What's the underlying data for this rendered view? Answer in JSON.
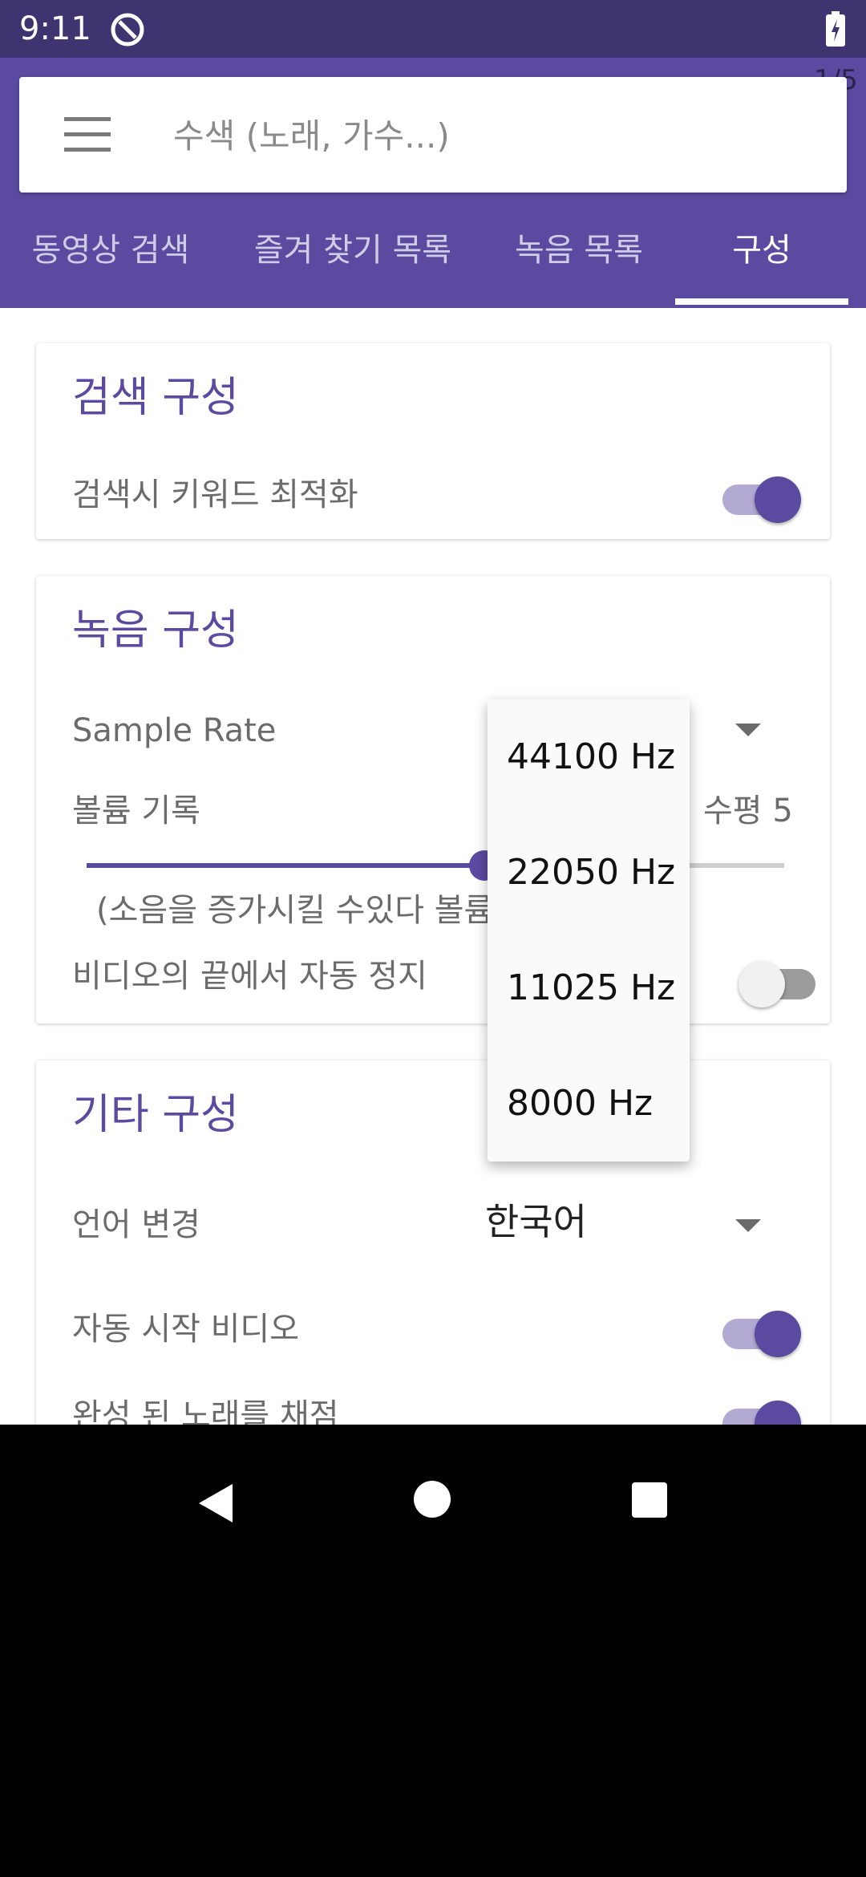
{
  "status_bar": {
    "time": "9:11"
  },
  "page_indicator": "1/5",
  "search": {
    "placeholder": "수색 (노래, 가수...)"
  },
  "tabs": [
    {
      "label": "동영상 검색"
    },
    {
      "label": "즐겨 찾기 목록"
    },
    {
      "label": "녹음 목록"
    },
    {
      "label": "구성",
      "selected": true
    }
  ],
  "search_settings": {
    "title": "검색 구성",
    "keyword_optimization_label": "검색시 키워드 최적화",
    "keyword_optimization_on": true
  },
  "recording_settings": {
    "title": "녹음 구성",
    "sample_rate_label": "Sample Rate",
    "volume_label": "볼륨 기록",
    "volume_level_text": "수평 5",
    "volume_note": "(소음을 증가시킬 수있다 볼륨",
    "volume_fraction": 0.57,
    "auto_stop_label": "비디오의 끝에서 자동 정지",
    "auto_stop_on": false
  },
  "other_settings": {
    "title": "기타 구성",
    "language_label": "언어 변경",
    "language_value": "한국어",
    "autostart_label": "자동 시작 비디오",
    "autostart_on": true,
    "score_label": "완성 된 노래를 채점",
    "score_on": true
  },
  "sample_rate_options": [
    "44100 Hz",
    "22050 Hz",
    "11025 Hz",
    "8000 Hz"
  ],
  "colors": {
    "accent": "#5b4aa0",
    "status_bar": "#3f3370",
    "nav_bar": "#000000"
  }
}
